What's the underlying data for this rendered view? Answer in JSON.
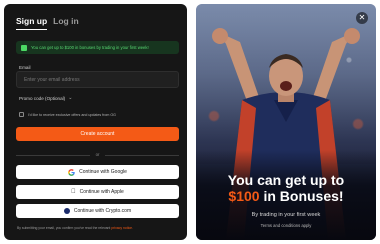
{
  "tabs": [
    {
      "label": "Sign up",
      "active": true
    },
    {
      "label": "Log in",
      "active": false
    }
  ],
  "promo_banner": {
    "text": "You can get up to $100 in bonuses by trading in your first week!",
    "color": "#58d872"
  },
  "email": {
    "label": "Email",
    "placeholder": "Enter your email address",
    "value": ""
  },
  "promo_code": {
    "label": "Promo code (Optional)",
    "icon": "chevron-down-icon"
  },
  "consent": {
    "text": "I'd like to receive exclusive offers and updates from OG",
    "checked": false
  },
  "create_account": {
    "label": "Create account",
    "color": "#f45a16"
  },
  "divider": {
    "label": "or"
  },
  "sso": {
    "google": "Continue with Google",
    "apple": "Continue with Apple",
    "crypto": "Continue with Crypto.com"
  },
  "legal": {
    "prefix": "By submitting your email, you confirm you've read the relevant",
    "link": "privacy notice."
  },
  "hero": {
    "headline_prefix": "You can get up to",
    "headline_amount": "$100",
    "headline_suffix": "in Bonuses!",
    "subtitle": "By trading in your first week",
    "terms": "Terms and conditions apply"
  }
}
